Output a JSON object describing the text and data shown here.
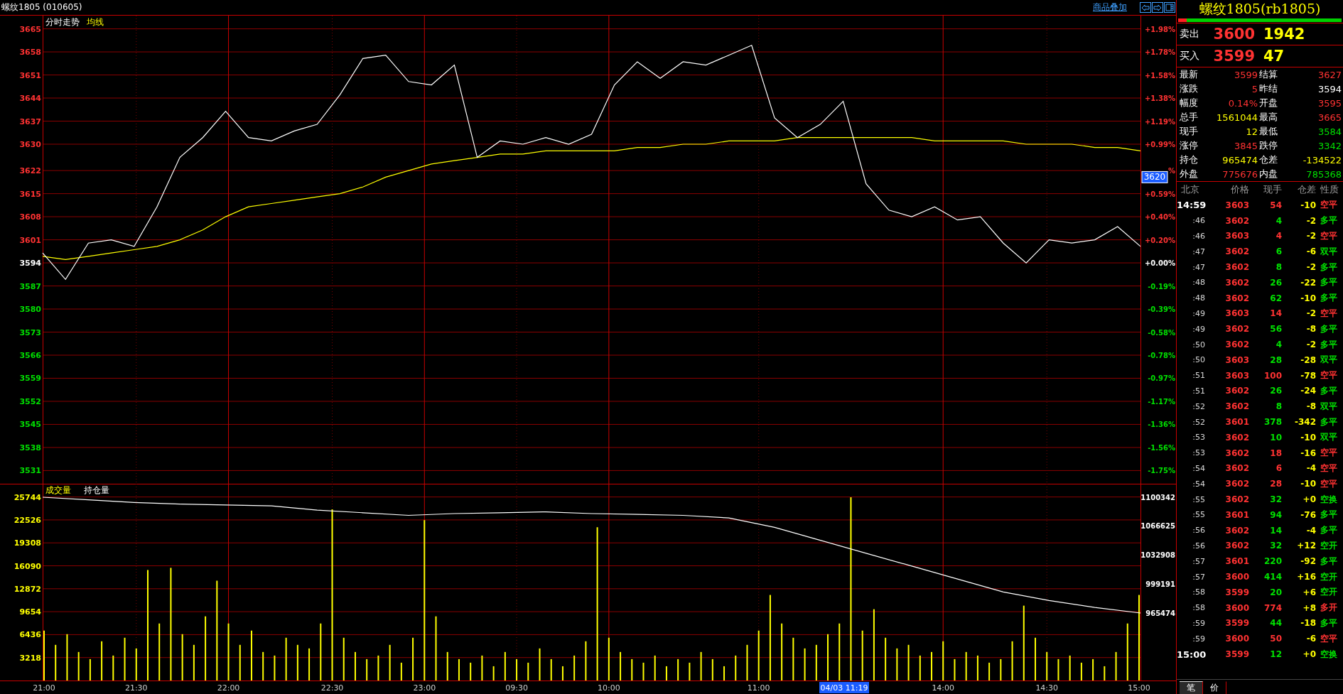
{
  "title_bar": {
    "title": "螺纹1805 (010605)",
    "link": "商品叠加"
  },
  "price_chart": {
    "chart_data": {
      "type": "line",
      "series": [
        {
          "name": "分时走势",
          "color": "#ffffff",
          "values": [
            3597,
            3589,
            3600,
            3601,
            3599,
            3611,
            3626,
            3632,
            3640,
            3632,
            3631,
            3634,
            3636,
            3645,
            3656,
            3657,
            3649,
            3648,
            3654,
            3626,
            3631,
            3630,
            3632,
            3630,
            3633,
            3648,
            3655,
            3650,
            3655,
            3654,
            3657,
            3660,
            3638,
            3632,
            3636,
            3643,
            3618,
            3610,
            3608,
            3611,
            3607,
            3608,
            3600,
            3594,
            3601,
            3600,
            3601,
            3605,
            3599
          ]
        },
        {
          "name": "均线",
          "color": "#ffff00",
          "values": [
            3596,
            3595,
            3596,
            3597,
            3598,
            3599,
            3601,
            3604,
            3608,
            3611,
            3612,
            3613,
            3614,
            3615,
            3617,
            3620,
            3622,
            3624,
            3625,
            3626,
            3627,
            3627,
            3628,
            3628,
            3628,
            3628,
            3629,
            3629,
            3630,
            3630,
            3631,
            3631,
            3631,
            3632,
            3632,
            3632,
            3632,
            3632,
            3632,
            3631,
            3631,
            3631,
            3631,
            3630,
            3630,
            3630,
            3629,
            3629,
            3628
          ]
        }
      ],
      "ylim": [
        3527,
        3669
      ],
      "yticks": [
        3665,
        3658,
        3651,
        3644,
        3637,
        3630,
        3622,
        3615,
        3608,
        3601,
        3594,
        3587,
        3580,
        3573,
        3566,
        3559,
        3552,
        3545,
        3538,
        3531
      ],
      "grid": true
    },
    "percent_labels": [
      {
        "label": "+1.98%",
        "kind": "up"
      },
      {
        "label": "+1.78%",
        "kind": "up"
      },
      {
        "label": "+1.58%",
        "kind": "up"
      },
      {
        "label": "+1.38%",
        "kind": "up"
      },
      {
        "label": "+1.19%",
        "kind": "up"
      },
      {
        "label": "+0.99%",
        "kind": "up"
      },
      {
        "label": "%",
        "kind": "up"
      },
      {
        "label": "+0.59%",
        "kind": "up"
      },
      {
        "label": "+0.40%",
        "kind": "up"
      },
      {
        "label": "+0.20%",
        "kind": "up"
      },
      {
        "label": "+0.00%",
        "kind": "flat"
      },
      {
        "label": "-0.19%",
        "kind": "down"
      },
      {
        "label": "-0.39%",
        "kind": "down"
      },
      {
        "label": "-0.58%",
        "kind": "down"
      },
      {
        "label": "-0.78%",
        "kind": "down"
      },
      {
        "label": "-0.97%",
        "kind": "down"
      },
      {
        "label": "-1.17%",
        "kind": "down"
      },
      {
        "label": "-1.36%",
        "kind": "down"
      },
      {
        "label": "-1.56%",
        "kind": "down"
      },
      {
        "label": "-1.75%",
        "kind": "down"
      }
    ]
  },
  "volume_chart": {
    "chart_data": {
      "type": "bar",
      "series": [
        {
          "name": "成交量",
          "color": "#ffff00",
          "values": [
            7000,
            5000,
            6500,
            4000,
            3000,
            5500,
            3500,
            6000,
            4500,
            15500,
            8000,
            15800,
            6500,
            5000,
            9000,
            14000,
            8000,
            5000,
            7000,
            4000,
            3500,
            6000,
            5000,
            4500,
            8000,
            24000,
            6000,
            4000,
            3000,
            3500,
            5000,
            2500,
            6000,
            22500,
            9000,
            4000,
            3000,
            2500,
            3500,
            2000,
            4000,
            3000,
            2500,
            4500,
            3000,
            2000,
            3500,
            5500,
            21500,
            6000,
            4000,
            3000,
            2500,
            3500,
            2000,
            3000,
            2500,
            4000,
            3000,
            2000,
            3500,
            5000,
            7000,
            12000,
            8000,
            6000,
            4500,
            5000,
            6500,
            8000,
            25700,
            7000,
            10000,
            6000,
            4500,
            5000,
            3500,
            4000,
            5500,
            3000,
            4000,
            3500,
            2500,
            3000,
            5500,
            10500,
            6000,
            4000,
            3000,
            3500,
            2500,
            3000,
            2000,
            4000,
            8000,
            12000
          ]
        }
      ],
      "categories": [
        "21:00",
        null,
        null,
        null,
        null,
        null,
        null,
        null,
        "21:30",
        null,
        null,
        null,
        null,
        null,
        null,
        null,
        "22:00",
        null,
        null,
        null,
        null,
        null,
        null,
        null,
        null,
        "22:30",
        null,
        null,
        null,
        null,
        null,
        null,
        null,
        "23:00",
        null,
        null,
        null,
        null,
        null,
        null,
        null,
        "09:30",
        null,
        null,
        null,
        null,
        null,
        null,
        null,
        "10:00",
        null,
        null,
        null,
        null,
        null,
        null,
        null,
        null,
        null,
        null,
        null,
        null,
        "11:00",
        null,
        null,
        null,
        null,
        null,
        null,
        null,
        null,
        null,
        null,
        null,
        null,
        null,
        null,
        null,
        "14:00",
        null,
        null,
        null,
        null,
        null,
        null,
        null,
        null,
        "14:30",
        null,
        null,
        null,
        null,
        null,
        null,
        null,
        "15:00"
      ],
      "grid": true,
      "ylim": [
        0,
        27600
      ],
      "yticks": [
        3218,
        6436,
        9654,
        12872,
        16090,
        19308,
        22526,
        25744
      ]
    }
  },
  "open_interest_chart": {
    "chart_data": {
      "type": "line",
      "series": [
        {
          "name": "持仓量",
          "color": "#ffffff",
          "values": [
            1100000,
            1097000,
            1094000,
            1092000,
            1091000,
            1090000,
            1085000,
            1082000,
            1079000,
            1081000,
            1082000,
            1083000,
            1081000,
            1080000,
            1079000,
            1076000,
            1065000,
            1050000,
            1035000,
            1020000,
            1005000,
            990000,
            980000,
            972000,
            965474
          ]
        }
      ],
      "ylim": [
        965474,
        1100342
      ],
      "yticks": [
        965474,
        999191,
        1032908,
        1066625,
        1100342
      ]
    }
  },
  "cursor": {
    "price": "3620",
    "time": "04/03 11:19"
  },
  "quote_panel": {
    "title": "螺纹1805(rb1805)",
    "ratio_bar": {
      "level": 0.05
    },
    "ask": {
      "label": "卖出",
      "price": "3600",
      "volume": "1942"
    },
    "bid": {
      "label": "买入",
      "price": "3599",
      "volume": "47"
    },
    "stats": [
      {
        "label": "最新",
        "value": "3599",
        "color": "#ff3232"
      },
      {
        "label": "结算",
        "value": "3627",
        "color": "#ff3232"
      },
      {
        "label": "涨跌",
        "value": "5",
        "color": "#ff3232"
      },
      {
        "label": "昨结",
        "value": "3594",
        "color": "#ffffff"
      },
      {
        "label": "幅度",
        "value": "0.14%",
        "color": "#ff3232"
      },
      {
        "label": "开盘",
        "value": "3595",
        "color": "#ff3232"
      },
      {
        "label": "总手",
        "value": "1561044",
        "color": "#ffff00"
      },
      {
        "label": "最高",
        "value": "3665",
        "color": "#ff3232"
      },
      {
        "label": "现手",
        "value": "12",
        "color": "#ffff00"
      },
      {
        "label": "最低",
        "value": "3584",
        "color": "#00e000"
      },
      {
        "label": "涨停",
        "value": "3845",
        "color": "#ff3232"
      },
      {
        "label": "跌停",
        "value": "3342",
        "color": "#00e000"
      },
      {
        "label": "持仓",
        "value": "965474",
        "color": "#ffff00"
      },
      {
        "label": "仓差",
        "value": "-134522",
        "color": "#ffff00"
      },
      {
        "label": "外盘",
        "value": "775676",
        "color": "#ff3232"
      },
      {
        "label": "内盘",
        "value": "785368",
        "color": "#00e000"
      }
    ],
    "ticks": {
      "columns": [
        "北京",
        "价格",
        "现手",
        "仓差",
        "性质"
      ],
      "rows": [
        {
          "time": "14:59",
          "kind": "hour",
          "price": "3603",
          "qty": {
            "text": "54",
            "color": "#ff3232"
          },
          "diff": "-10",
          "nature": {
            "text": "空平",
            "color": "#ff3232"
          }
        },
        {
          "time": ":46",
          "kind": "minute",
          "price": "3602",
          "qty": {
            "text": "4",
            "color": "#00e000"
          },
          "diff": "-2",
          "nature": {
            "text": "多平",
            "color": "#00e000"
          }
        },
        {
          "time": ":46",
          "kind": "minute",
          "price": "3603",
          "qty": {
            "text": "4",
            "color": "#ff3232"
          },
          "diff": "-2",
          "nature": {
            "text": "空平",
            "color": "#ff3232"
          }
        },
        {
          "time": ":47",
          "kind": "minute",
          "price": "3602",
          "qty": {
            "text": "6",
            "color": "#00e000"
          },
          "diff": "-6",
          "nature": {
            "text": "双平",
            "color": "#00e000"
          }
        },
        {
          "time": ":47",
          "kind": "minute",
          "price": "3602",
          "qty": {
            "text": "8",
            "color": "#00e000"
          },
          "diff": "-2",
          "nature": {
            "text": "多平",
            "color": "#00e000"
          }
        },
        {
          "time": ":48",
          "kind": "minute",
          "price": "3602",
          "qty": {
            "text": "26",
            "color": "#00e000"
          },
          "diff": "-22",
          "nature": {
            "text": "多平",
            "color": "#00e000"
          }
        },
        {
          "time": ":48",
          "kind": "minute",
          "price": "3602",
          "qty": {
            "text": "62",
            "color": "#00e000"
          },
          "diff": "-10",
          "nature": {
            "text": "多平",
            "color": "#00e000"
          }
        },
        {
          "time": ":49",
          "kind": "minute",
          "price": "3603",
          "qty": {
            "text": "14",
            "color": "#ff3232"
          },
          "diff": "-2",
          "nature": {
            "text": "空平",
            "color": "#ff3232"
          }
        },
        {
          "time": ":49",
          "kind": "minute",
          "price": "3602",
          "qty": {
            "text": "56",
            "color": "#00e000"
          },
          "diff": "-8",
          "nature": {
            "text": "多平",
            "color": "#00e000"
          }
        },
        {
          "time": ":50",
          "kind": "minute",
          "price": "3602",
          "qty": {
            "text": "4",
            "color": "#00e000"
          },
          "diff": "-2",
          "nature": {
            "text": "多平",
            "color": "#00e000"
          }
        },
        {
          "time": ":50",
          "kind": "minute",
          "price": "3603",
          "qty": {
            "text": "28",
            "color": "#00e000"
          },
          "diff": "-28",
          "nature": {
            "text": "双平",
            "color": "#00e000"
          }
        },
        {
          "time": ":51",
          "kind": "minute",
          "price": "3603",
          "qty": {
            "text": "100",
            "color": "#ff3232"
          },
          "diff": "-78",
          "nature": {
            "text": "空平",
            "color": "#ff3232"
          }
        },
        {
          "time": ":51",
          "kind": "minute",
          "price": "3602",
          "qty": {
            "text": "26",
            "color": "#00e000"
          },
          "diff": "-24",
          "nature": {
            "text": "多平",
            "color": "#00e000"
          }
        },
        {
          "time": ":52",
          "kind": "minute",
          "price": "3602",
          "qty": {
            "text": "8",
            "color": "#00e000"
          },
          "diff": "-8",
          "nature": {
            "text": "双平",
            "color": "#00e000"
          }
        },
        {
          "time": ":52",
          "kind": "minute",
          "price": "3601",
          "qty": {
            "text": "378",
            "color": "#00e000"
          },
          "diff": "-342",
          "nature": {
            "text": "多平",
            "color": "#00e000"
          }
        },
        {
          "time": ":53",
          "kind": "minute",
          "price": "3602",
          "qty": {
            "text": "10",
            "color": "#00e000"
          },
          "diff": "-10",
          "nature": {
            "text": "双平",
            "color": "#00e000"
          }
        },
        {
          "time": ":53",
          "kind": "minute",
          "price": "3602",
          "qty": {
            "text": "18",
            "color": "#ff3232"
          },
          "diff": "-16",
          "nature": {
            "text": "空平",
            "color": "#ff3232"
          }
        },
        {
          "time": ":54",
          "kind": "minute",
          "price": "3602",
          "qty": {
            "text": "6",
            "color": "#ff3232"
          },
          "diff": "-4",
          "nature": {
            "text": "空平",
            "color": "#ff3232"
          }
        },
        {
          "time": ":54",
          "kind": "minute",
          "price": "3602",
          "qty": {
            "text": "28",
            "color": "#ff3232"
          },
          "diff": "-10",
          "nature": {
            "text": "空平",
            "color": "#ff3232"
          }
        },
        {
          "time": ":55",
          "kind": "minute",
          "price": "3602",
          "qty": {
            "text": "32",
            "color": "#00e000"
          },
          "diff": "+0",
          "nature": {
            "text": "空换",
            "color": "#00e000"
          }
        },
        {
          "time": ":55",
          "kind": "minute",
          "price": "3601",
          "qty": {
            "text": "94",
            "color": "#00e000"
          },
          "diff": "-76",
          "nature": {
            "text": "多平",
            "color": "#00e000"
          }
        },
        {
          "time": ":56",
          "kind": "minute",
          "price": "3602",
          "qty": {
            "text": "14",
            "color": "#00e000"
          },
          "diff": "-4",
          "nature": {
            "text": "多平",
            "color": "#00e000"
          }
        },
        {
          "time": ":56",
          "kind": "minute",
          "price": "3602",
          "qty": {
            "text": "32",
            "color": "#00e000"
          },
          "diff": "+12",
          "nature": {
            "text": "空开",
            "color": "#00e000"
          }
        },
        {
          "time": ":57",
          "kind": "minute",
          "price": "3601",
          "qty": {
            "text": "220",
            "color": "#00e000"
          },
          "diff": "-92",
          "nature": {
            "text": "多平",
            "color": "#00e000"
          }
        },
        {
          "time": ":57",
          "kind": "minute",
          "price": "3600",
          "qty": {
            "text": "414",
            "color": "#00e000"
          },
          "diff": "+16",
          "nature": {
            "text": "空开",
            "color": "#00e000"
          }
        },
        {
          "time": ":58",
          "kind": "minute",
          "price": "3599",
          "qty": {
            "text": "20",
            "color": "#00e000"
          },
          "diff": "+6",
          "nature": {
            "text": "空开",
            "color": "#00e000"
          }
        },
        {
          "time": ":58",
          "kind": "minute",
          "price": "3600",
          "qty": {
            "text": "774",
            "color": "#ff3232"
          },
          "diff": "+8",
          "nature": {
            "text": "多开",
            "color": "#ff3232"
          }
        },
        {
          "time": ":59",
          "kind": "minute",
          "price": "3599",
          "qty": {
            "text": "44",
            "color": "#00e000"
          },
          "diff": "-18",
          "nature": {
            "text": "多平",
            "color": "#00e000"
          }
        },
        {
          "time": ":59",
          "kind": "minute",
          "price": "3600",
          "qty": {
            "text": "50",
            "color": "#ff3232"
          },
          "diff": "-6",
          "nature": {
            "text": "空平",
            "color": "#ff3232"
          }
        },
        {
          "time": "15:00",
          "kind": "hour",
          "price": "3599",
          "qty": {
            "text": "12",
            "color": "#00e000"
          },
          "diff": "+0",
          "nature": {
            "text": "空换",
            "color": "#00e000"
          }
        }
      ]
    },
    "tabs": [
      {
        "label": "笔",
        "selected": true
      },
      {
        "label": "价",
        "selected": false
      }
    ]
  }
}
